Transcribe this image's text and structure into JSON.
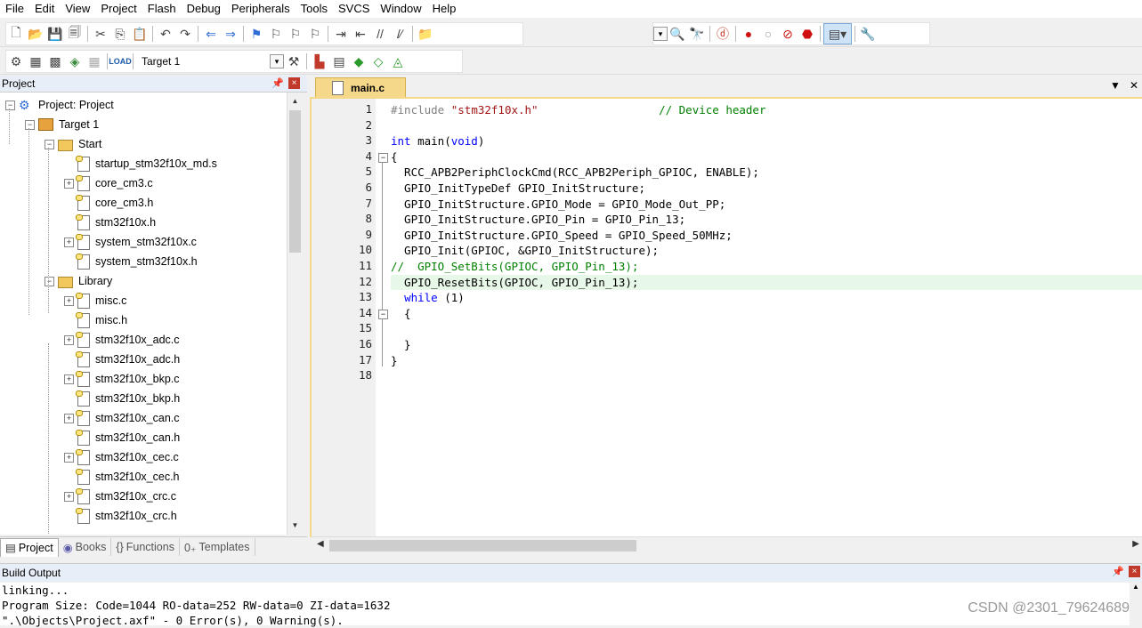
{
  "menu": [
    "File",
    "Edit",
    "View",
    "Project",
    "Flash",
    "Debug",
    "Peripherals",
    "Tools",
    "SVCS",
    "Window",
    "Help"
  ],
  "toolbar": {
    "target": "Target 1"
  },
  "project_panel": {
    "title": "Project",
    "tree": [
      {
        "label": "Project: Project",
        "type": "project",
        "level": 0,
        "expander": "minus"
      },
      {
        "label": "Target 1",
        "type": "target",
        "level": 1,
        "expander": "minus"
      },
      {
        "label": "Start",
        "type": "folder",
        "level": 2,
        "expander": "minus"
      },
      {
        "label": "startup_stm32f10x_md.s",
        "type": "file",
        "level": 3,
        "expander": ""
      },
      {
        "label": "core_cm3.c",
        "type": "file",
        "level": 3,
        "expander": "plus"
      },
      {
        "label": "core_cm3.h",
        "type": "file",
        "level": 3,
        "expander": ""
      },
      {
        "label": "stm32f10x.h",
        "type": "file",
        "level": 3,
        "expander": ""
      },
      {
        "label": "system_stm32f10x.c",
        "type": "file",
        "level": 3,
        "expander": "plus"
      },
      {
        "label": "system_stm32f10x.h",
        "type": "file",
        "level": 3,
        "expander": ""
      },
      {
        "label": "Library",
        "type": "folder",
        "level": 2,
        "expander": "minus"
      },
      {
        "label": "misc.c",
        "type": "file",
        "level": 3,
        "expander": "plus"
      },
      {
        "label": "misc.h",
        "type": "file",
        "level": 3,
        "expander": ""
      },
      {
        "label": "stm32f10x_adc.c",
        "type": "file",
        "level": 3,
        "expander": "plus"
      },
      {
        "label": "stm32f10x_adc.h",
        "type": "file",
        "level": 3,
        "expander": ""
      },
      {
        "label": "stm32f10x_bkp.c",
        "type": "file",
        "level": 3,
        "expander": "plus"
      },
      {
        "label": "stm32f10x_bkp.h",
        "type": "file",
        "level": 3,
        "expander": ""
      },
      {
        "label": "stm32f10x_can.c",
        "type": "file",
        "level": 3,
        "expander": "plus"
      },
      {
        "label": "stm32f10x_can.h",
        "type": "file",
        "level": 3,
        "expander": ""
      },
      {
        "label": "stm32f10x_cec.c",
        "type": "file",
        "level": 3,
        "expander": "plus"
      },
      {
        "label": "stm32f10x_cec.h",
        "type": "file",
        "level": 3,
        "expander": ""
      },
      {
        "label": "stm32f10x_crc.c",
        "type": "file",
        "level": 3,
        "expander": "plus"
      },
      {
        "label": "stm32f10x_crc.h",
        "type": "file",
        "level": 3,
        "expander": ""
      }
    ],
    "tabs": [
      "Project",
      "Books",
      "Functions",
      "Templates"
    ]
  },
  "editor": {
    "tab": "main.c",
    "lines": [
      {
        "n": "1",
        "html": "<span class=\"pp\">#include</span> <span class=\"str\">\"stm32f10x.h\"</span>                  <span class=\"cm\">// Device header</span>"
      },
      {
        "n": "2",
        "html": ""
      },
      {
        "n": "3",
        "html": "<span class=\"kw\">int</span> main(<span class=\"kw\">void</span>)"
      },
      {
        "n": "4",
        "html": "{"
      },
      {
        "n": "5",
        "html": "  RCC_APB2PeriphClockCmd(RCC_APB2Periph_GPIOC, ENABLE);"
      },
      {
        "n": "6",
        "html": "  GPIO_InitTypeDef GPIO_InitStructure;"
      },
      {
        "n": "7",
        "html": "  GPIO_InitStructure.GPIO_Mode = GPIO_Mode_Out_PP;"
      },
      {
        "n": "8",
        "html": "  GPIO_InitStructure.GPIO_Pin = GPIO_Pin_13;"
      },
      {
        "n": "9",
        "html": "  GPIO_InitStructure.GPIO_Speed = GPIO_Speed_50MHz;"
      },
      {
        "n": "10",
        "html": "  GPIO_Init(GPIOC, &amp;GPIO_InitStructure);"
      },
      {
        "n": "11",
        "html": "<span class=\"cm\">//  GPIO_SetBits(GPIOC, GPIO_Pin_13);</span>"
      },
      {
        "n": "12",
        "html": "  GPIO_ResetBits(GPIOC, GPIO_Pin_13);",
        "highlight": true
      },
      {
        "n": "13",
        "html": "  <span class=\"kw\">while</span> (1)"
      },
      {
        "n": "14",
        "html": "  {"
      },
      {
        "n": "15",
        "html": ""
      },
      {
        "n": "16",
        "html": "  }"
      },
      {
        "n": "17",
        "html": "}"
      },
      {
        "n": "18",
        "html": ""
      }
    ]
  },
  "build_output": {
    "title": "Build Output",
    "lines": [
      "linking...",
      "Program Size: Code=1044 RO-data=252 RW-data=0 ZI-data=1632",
      "\".\\Objects\\Project.axf\" - 0 Error(s), 0 Warning(s)."
    ]
  },
  "watermark": "CSDN @2301_79624689"
}
